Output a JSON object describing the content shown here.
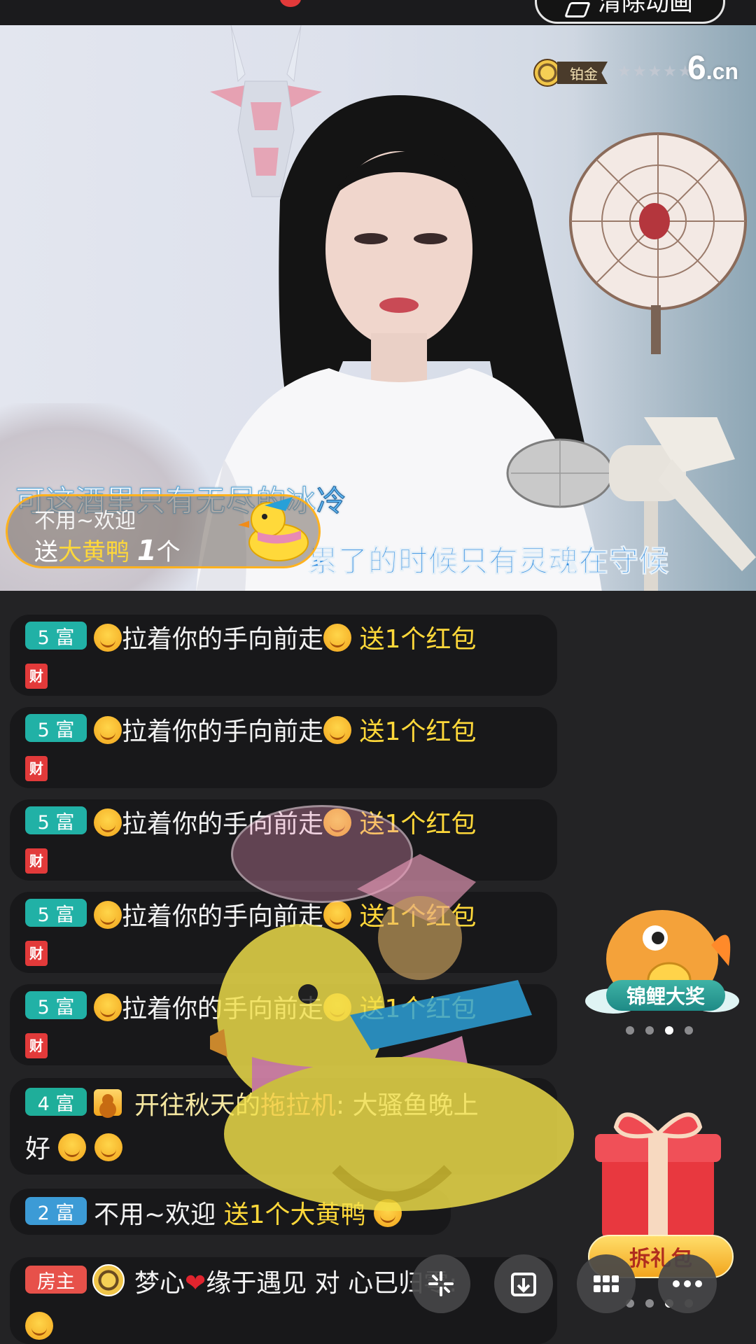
{
  "header": {
    "clear_screen_label": "清除动画"
  },
  "video": {
    "platform_badge": "铂金",
    "stars": "★★★★★",
    "logo": "6",
    "logo_suffix": ".cn",
    "lyric_line1": "可这酒里只有无尽的冰",
    "lyric_line1_highlight": "冷",
    "lyric_line2": "累了的时候只有灵魂在守候",
    "gift_toast": {
      "user": "不用~欢迎",
      "prefix": "送",
      "gift": "大黄鸭",
      "count": "1",
      "unit": "个"
    }
  },
  "chat": {
    "red_packet_messages": [
      {
        "level": "5 富",
        "user": "拉着你的手向前走",
        "action": "送1个红包",
        "tag": "财"
      },
      {
        "level": "5 富",
        "user": "拉着你的手向前走",
        "action": "送1个红包",
        "tag": "财"
      },
      {
        "level": "5 富",
        "user": "拉着你的手向前走",
        "action": "送1个红包",
        "tag": "财"
      },
      {
        "level": "5 富",
        "user": "拉着你的手向前走",
        "action": "送1个红包",
        "tag": "财"
      },
      {
        "level": "5 富",
        "user": "拉着你的手向前走",
        "action": "送1个红包",
        "tag": "财"
      }
    ],
    "message_tractor": {
      "level": "4 富",
      "user": "开往秋天的",
      "user_hl": "拖拉机",
      "text": ": 大骚鱼晚上",
      "text2": "好"
    },
    "message_gift": {
      "level": "2 富",
      "user": "不用~欢迎",
      "action": "送1个大黄鸭"
    },
    "message_host": {
      "level": "房主",
      "user": "梦心",
      "user2": "缘于遇见 对 心已归零:"
    }
  },
  "widgets": {
    "koi_label": "锦鲤大奖",
    "gift_pack_label": "拆礼包"
  },
  "bottom_bar": {
    "share_icon": "share-icon",
    "download_icon": "download-icon",
    "grid_icon": "grid-icon",
    "more_icon": "more-icon"
  },
  "colors": {
    "accent_gold": "#ffd83a",
    "level_teal": "#21b1a6",
    "host_red": "#e7514a",
    "lyric_blue": "#2d8be0"
  }
}
